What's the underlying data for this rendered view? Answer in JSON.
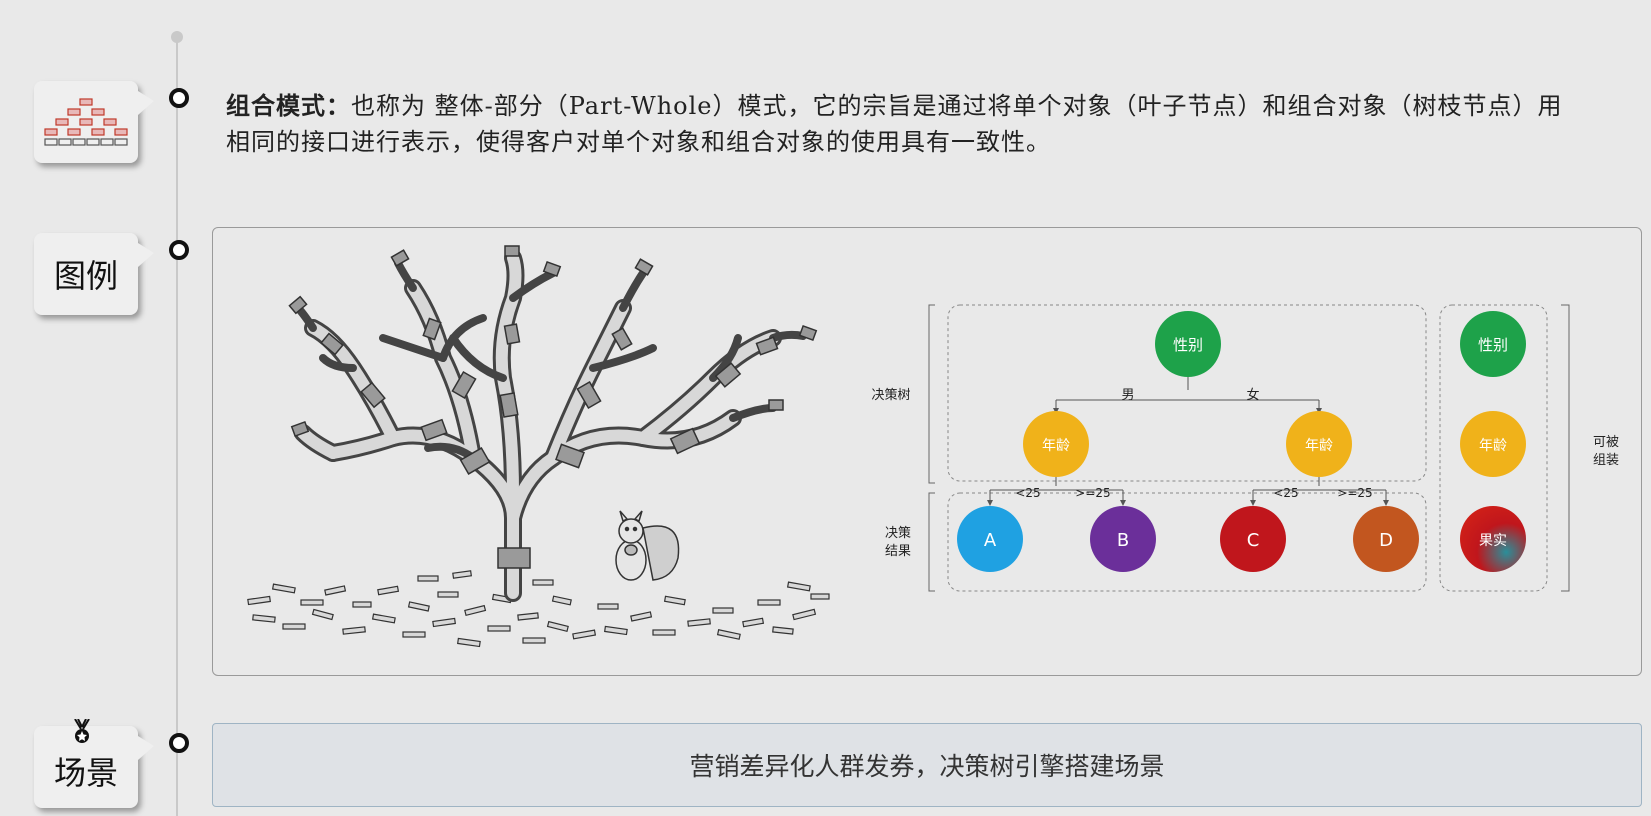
{
  "sections": {
    "intro_tag_icon": "tree-structure-icon",
    "example_label": "图例",
    "scene_label": "场景",
    "scene_icon": "medal-icon"
  },
  "intro": {
    "term": "组合模式：",
    "body": "也称为 整体-部分（Part-Whole）模式，它的宗旨是通过将单个对象（叶子节点）和组合对象（树枝节点）用相同的接口进行表示，使得客户对单个对象和组合对象的使用具有一致性。"
  },
  "diagram": {
    "illustration": "tree-with-squirrel-illustration",
    "decision_tree_label": "决策树",
    "decision_result_label": "决策结果",
    "root": "性别",
    "left_edge": "男",
    "right_edge": "女",
    "left_node": "年龄",
    "right_node": "年龄",
    "age_lt": "<25",
    "age_ge": ">=25",
    "leaf_a": "A",
    "leaf_b": "B",
    "leaf_c": "C",
    "leaf_d": "D",
    "legend_gender": "性别",
    "legend_age": "年龄",
    "legend_fruit": "果实",
    "composable_label": "可被组装",
    "colors": {
      "green": "#1ea24a",
      "yellow": "#f0b21a",
      "blue": "#1fa1e2",
      "purple": "#6b2f9a",
      "red": "#c0161c",
      "orange": "#c2561f"
    }
  },
  "scene": {
    "text": "营销差异化人群发券，决策树引擎搭建场景"
  }
}
